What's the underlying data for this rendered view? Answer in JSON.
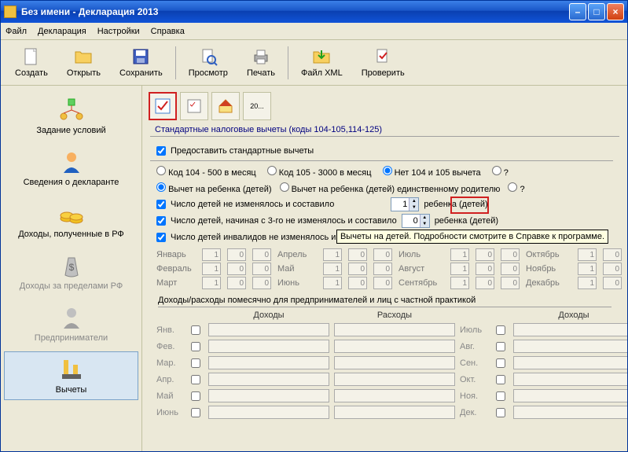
{
  "title": "Без имени - Декларация 2013",
  "menu": {
    "file": "Файл",
    "decl": "Декларация",
    "settings": "Настройки",
    "help": "Справка"
  },
  "toolbar": {
    "create": "Создать",
    "open": "Открыть",
    "save": "Сохранить",
    "view": "Просмотр",
    "print": "Печать",
    "xml": "Файл XML",
    "check": "Проверить"
  },
  "sidebar": [
    {
      "label": "Задание условий"
    },
    {
      "label": "Сведения о декларанте"
    },
    {
      "label": "Доходы, полученные в РФ"
    },
    {
      "label": "Доходы за пределами РФ"
    },
    {
      "label": "Предприниматели"
    },
    {
      "label": "Вычеты"
    }
  ],
  "mini_tb": {
    "doc_no": "20..."
  },
  "section": {
    "title": "Стандартные налоговые вычеты (коды 104-105,114-125)",
    "provide": "Предоставить стандартные вычеты",
    "opt1": "Код 104 - 500 в месяц",
    "opt2": "Код 105 - 3000 в месяц",
    "opt3": "Нет 104 и 105 вычета",
    "child1": "Вычет на ребенка (детей)",
    "child2": "Вычет на ребенка (детей) единственному родителю",
    "count1": "Число детей не изменялось и составило",
    "count2": "Число детей, начиная с 3-го не изменялось и составило",
    "count3": "Число детей инвалидов не изменялось и составило",
    "suffix": "ребенка (детей)",
    "spin1": "1",
    "spin2": "0",
    "q": "?",
    "tooltip": "Вычеты на детей. Подробности смотрите в Справке к программе."
  },
  "months": {
    "m1": "Январь",
    "m2": "Февраль",
    "m3": "Март",
    "m4": "Апрель",
    "m5": "Май",
    "m6": "Июнь",
    "m7": "Июль",
    "m8": "Август",
    "m9": "Сентябрь",
    "m10": "Октябрь",
    "m11": "Ноябрь",
    "m12": "Декабрь",
    "v1": "1",
    "v0": "0"
  },
  "income": {
    "title": "Доходы/расходы помесячно для предпринимателей и лиц с частной практикой",
    "heads": {
      "inc": "Доходы",
      "exp": "Расходы"
    },
    "rows": {
      "r1a": "Янв.",
      "r1b": "Июль",
      "r2a": "Фев.",
      "r2b": "Авг.",
      "r3a": "Мар.",
      "r3b": "Сен.",
      "r4a": "Апр.",
      "r4b": "Окт.",
      "r5a": "Май",
      "r5b": "Ноя.",
      "r6a": "Июнь",
      "r6b": "Дек."
    }
  }
}
